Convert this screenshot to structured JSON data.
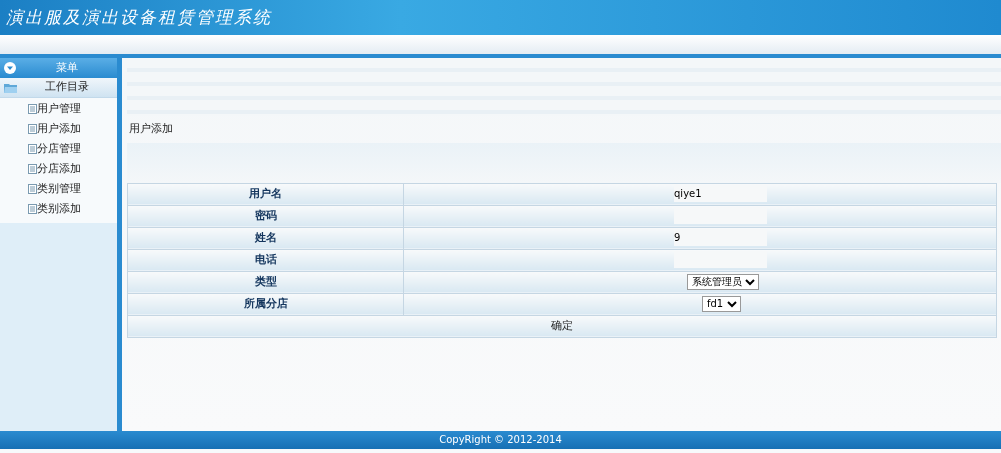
{
  "header": {
    "title": "演出服及演出设备租赁管理系统"
  },
  "sidebar": {
    "menu_title": "菜单",
    "folder": "工作目录",
    "items": [
      {
        "label": "用户管理"
      },
      {
        "label": "用户添加"
      },
      {
        "label": "分店管理"
      },
      {
        "label": "分店添加"
      },
      {
        "label": "类别管理"
      },
      {
        "label": "类别添加"
      }
    ]
  },
  "page_title": "用户添加",
  "form": {
    "rows": [
      {
        "label": "用户名",
        "kind": "text",
        "value": "qiye1"
      },
      {
        "label": "密码",
        "kind": "password"
      },
      {
        "label": "姓名",
        "kind": "text",
        "value": "9"
      },
      {
        "label": "电话",
        "kind": "text"
      },
      {
        "label": "类型",
        "kind": "select",
        "value": "系统管理员"
      },
      {
        "label": "所属分店",
        "kind": "select",
        "value": "fd1"
      }
    ],
    "submit": "确定"
  },
  "footer": "CopyRight © 2012-2014"
}
